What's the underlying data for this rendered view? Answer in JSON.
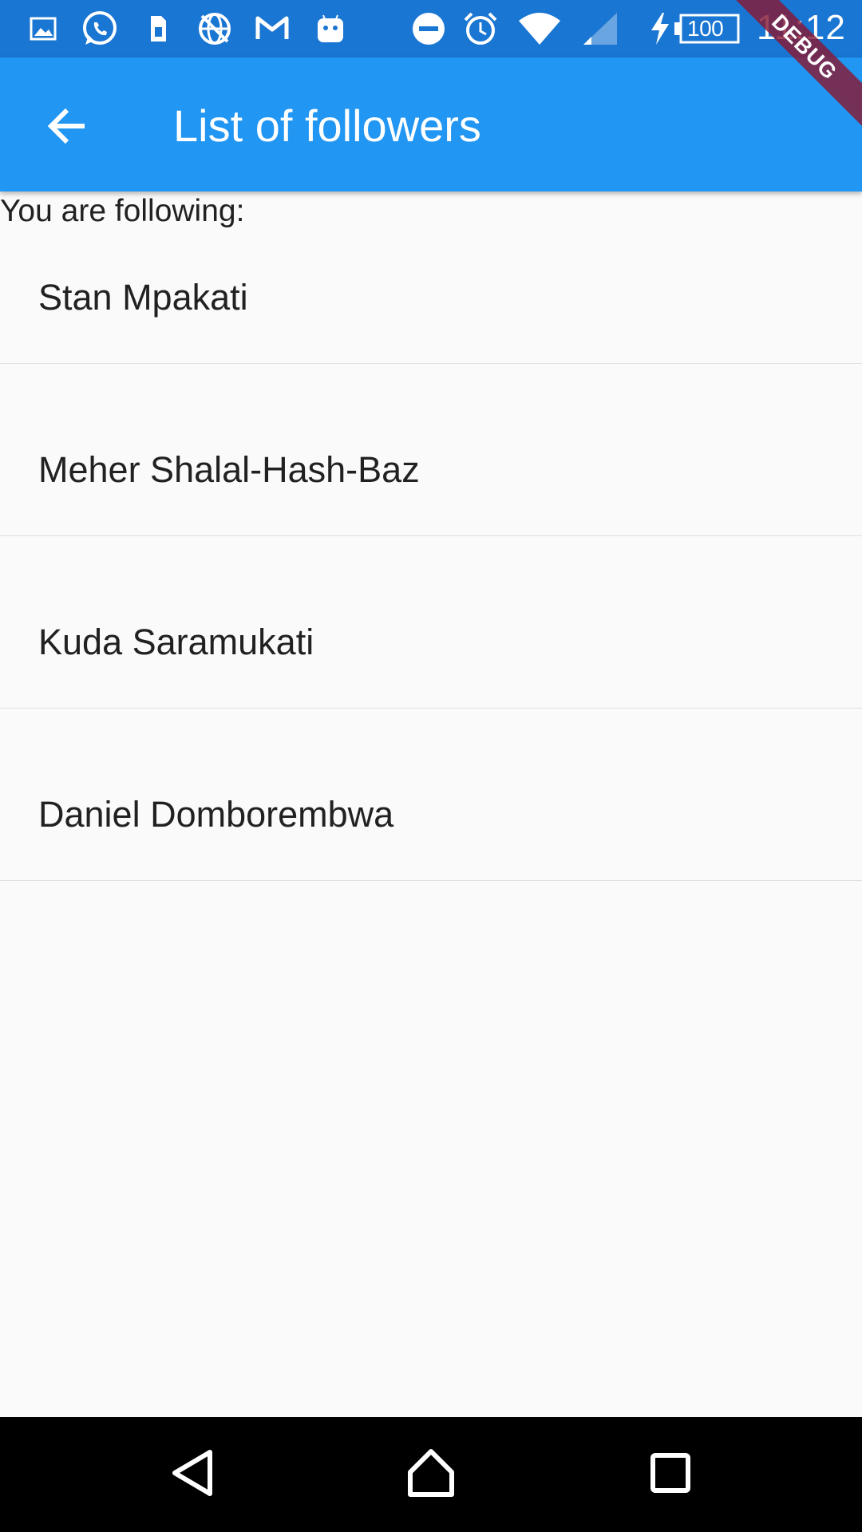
{
  "status_bar": {
    "icons_left": [
      "image-icon",
      "whatsapp-icon",
      "sim-card-icon",
      "no-data-globe-icon",
      "gmail-icon",
      "android-icon"
    ],
    "icons_right": [
      "do-not-disturb-icon",
      "alarm-icon",
      "wifi-icon",
      "cell-signal-icon",
      "charging-icon",
      "battery-icon"
    ],
    "battery_level": "100",
    "time": "11:12"
  },
  "debug_banner": {
    "label": "DEBUG",
    "color": "#881a36"
  },
  "app_bar": {
    "back_icon": "arrow-back-icon",
    "title": "List of followers",
    "color": "#2196f3"
  },
  "content": {
    "header": "You are following:",
    "followers": [
      {
        "name": "Stan Mpakati"
      },
      {
        "name": "Meher Shalal-Hash-Baz"
      },
      {
        "name": "Kuda Saramukati"
      },
      {
        "name": "Daniel Domborembwa"
      }
    ]
  },
  "nav_bar": {
    "buttons": [
      "back-triangle-icon",
      "home-icon",
      "recents-square-icon"
    ]
  },
  "colors": {
    "status_bar": "#1976d2",
    "app_bar": "#2196f3",
    "background": "#fafafa",
    "divider": "#e0e0e0",
    "nav_bar": "#000000"
  }
}
